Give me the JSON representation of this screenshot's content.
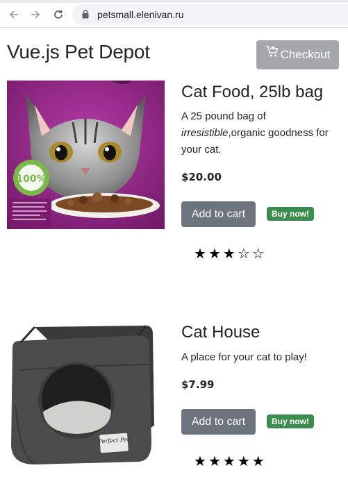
{
  "browser": {
    "url": "petsmall.elenivan.ru"
  },
  "header": {
    "brand": "Vue.js Pet Depot",
    "checkout_label": "Checkout"
  },
  "products": [
    {
      "title": "Cat Food, 25lb bag",
      "description_prefix": "A 25 pound bag of ",
      "description_em": "irresistible",
      "description_suffix": ",organic goodness for your cat.",
      "price": "$20.00",
      "add_label": "Add to cart",
      "badge": "Buy now!",
      "rating": 3,
      "rating_max": 5
    },
    {
      "title": "Cat House",
      "description": "A place for your cat to play!",
      "price": "$7.99",
      "add_label": "Add to cart",
      "badge": "Buy now!",
      "rating": 5,
      "rating_max": 5,
      "image_label": "Perfect Pet"
    }
  ],
  "colors": {
    "add_button": "#6c757d",
    "badge": "#3d8c4f",
    "checkout": "#a5a8ab"
  }
}
